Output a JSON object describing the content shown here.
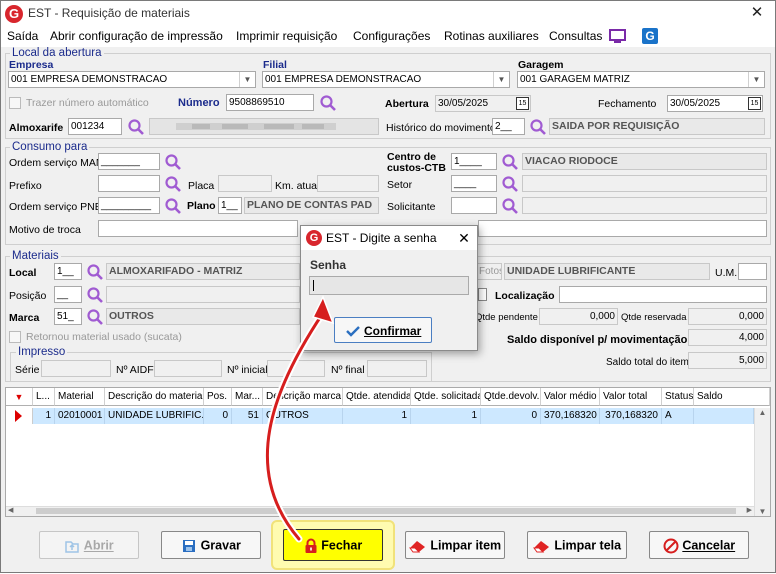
{
  "window": {
    "title": "EST - Requisição de materiais",
    "app_icon": "G"
  },
  "menu": [
    "Saída",
    "Abrir configuração de impressão",
    "Imprimir requisição",
    "Configurações",
    "Rotinas auxiliares",
    "Consultas"
  ],
  "local_abertura": {
    "group_title": "Local da abertura",
    "empresa_label": "Empresa",
    "empresa_value": "001 EMPRESA DEMONSTRACAO",
    "filial_label": "Filial",
    "filial_value": "001 EMPRESA DEMONSTRACAO",
    "garagem_label": "Garagem",
    "garagem_value": "001 GARAGEM MATRIZ",
    "trazer_label": "Trazer número automático",
    "numero_label": "Número",
    "numero_value": "9508869510",
    "abertura_label": "Abertura",
    "abertura_value": "30/05/2025",
    "fechamento_label": "Fechamento",
    "fechamento_value": "30/05/2025",
    "almoxarife_label": "Almoxarife",
    "almoxarife_value": "001234",
    "historico_label": "Histórico do movimento",
    "historico_code": "2__",
    "historico_desc": "SAIDA POR REQUISIÇÃO",
    "calendar_glyph": "15"
  },
  "consumo": {
    "group_title": "Consumo para",
    "os_man_label": "Ordem serviço MAN",
    "os_man_value": "_______",
    "prefixo_label": "Prefixo",
    "placa_label": "Placa",
    "km_label": "Km. atual",
    "os_pne_label": "Ordem serviço PNE",
    "os_pne_value": "_________",
    "plano_label": "Plano",
    "plano_code": "1__",
    "plano_desc": "PLANO DE CONTAS PAD",
    "motivo_label": "Motivo de troca",
    "centro_label_1": "Centro de",
    "centro_label_2": "custos-CTB",
    "centro_code": "1____",
    "centro_desc": "VIACAO RIODOCE",
    "setor_label": "Setor",
    "setor_code": "____",
    "solicitante_label": "Solicitante"
  },
  "materiais": {
    "group_title": "Materiais",
    "local_label": "Local",
    "local_code": "1__",
    "local_desc": "ALMOXARIFADO  - MATRIZ",
    "posicao_label": "Posição",
    "posicao_value": "__",
    "marca_label": "Marca",
    "marca_code": "51_",
    "marca_desc": "OUTROS",
    "retornou_label": "Retornou material usado (sucata)",
    "fotos_label": "Fotos",
    "material_desc": "UNIDADE LUBRIFICANTE",
    "um_label": "U.M.",
    "localizacao_label": "Localização",
    "qtde_pendente_label": "Qtde pendente",
    "qtde_pendente_value": "0,000",
    "qtde_reservada_label": "Qtde reservada",
    "qtde_reservada_value": "0,000",
    "saldo_disp_label": "Saldo disponível p/ movimentação",
    "saldo_disp_value": "4,000",
    "saldo_total_label": "Saldo total do item",
    "saldo_total_value": "5,000"
  },
  "impresso": {
    "group_title": "Impresso",
    "serie_label": "Série",
    "aidf_label": "Nº AIDF",
    "inicial_label": "Nº inicial",
    "final_label": "Nº final"
  },
  "grid": {
    "headers": [
      "L...",
      "Material",
      "Descrição do material",
      "Pos.",
      "Mar...",
      "Descrição marca",
      "Qtde. atendida",
      "Qtde. solicitada",
      "Qtde.devolv.",
      "Valor médio",
      "Valor total",
      "Status",
      "Saldo"
    ],
    "rows": [
      [
        "1",
        "02010001",
        "UNIDADE LUBRIFIC...",
        "0",
        "51",
        "OUTROS",
        "1",
        "1",
        "0",
        "370,168320",
        "370,168320",
        "A",
        ""
      ]
    ]
  },
  "buttons": {
    "abrir": "Abrir",
    "gravar": "Gravar",
    "fechar": "Fechar",
    "limpar_item": "Limpar item",
    "limpar_tela": "Limpar tela",
    "cancelar": "Cancelar"
  },
  "dialog": {
    "title": "EST - Digite a senha",
    "senha_label": "Senha",
    "senha_value": "",
    "confirm_label": "Confirmar"
  },
  "colors": {
    "label_blue": "#1b2b8c",
    "accent_purple": "#a05bd2",
    "highlight": "#fffbb0",
    "fechar_button": "#ffff00",
    "arrow_red": "#d61e1e"
  }
}
